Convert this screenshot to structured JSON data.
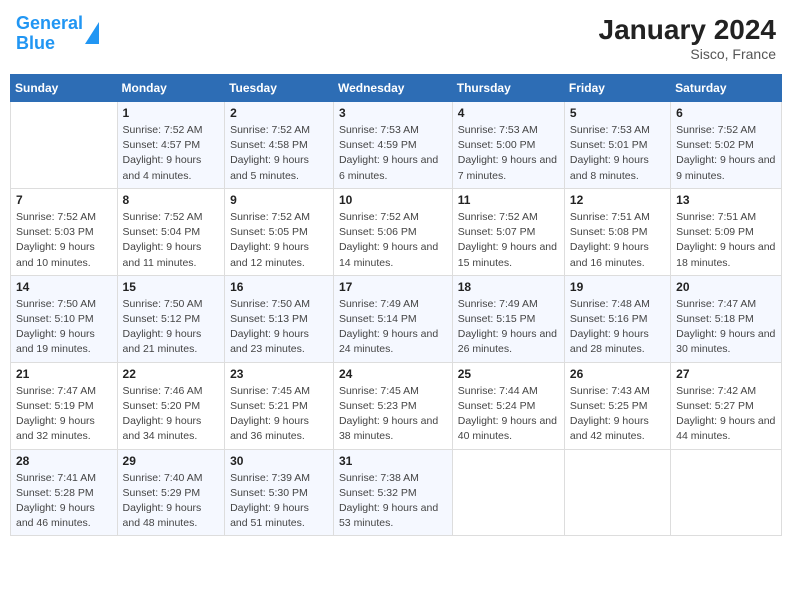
{
  "header": {
    "logo_line1": "General",
    "logo_line2": "Blue",
    "title": "January 2024",
    "subtitle": "Sisco, France"
  },
  "days_of_week": [
    "Sunday",
    "Monday",
    "Tuesday",
    "Wednesday",
    "Thursday",
    "Friday",
    "Saturday"
  ],
  "weeks": [
    [
      {
        "day": "",
        "sunrise": "",
        "sunset": "",
        "daylight": ""
      },
      {
        "day": "1",
        "sunrise": "Sunrise: 7:52 AM",
        "sunset": "Sunset: 4:57 PM",
        "daylight": "Daylight: 9 hours and 4 minutes."
      },
      {
        "day": "2",
        "sunrise": "Sunrise: 7:52 AM",
        "sunset": "Sunset: 4:58 PM",
        "daylight": "Daylight: 9 hours and 5 minutes."
      },
      {
        "day": "3",
        "sunrise": "Sunrise: 7:53 AM",
        "sunset": "Sunset: 4:59 PM",
        "daylight": "Daylight: 9 hours and 6 minutes."
      },
      {
        "day": "4",
        "sunrise": "Sunrise: 7:53 AM",
        "sunset": "Sunset: 5:00 PM",
        "daylight": "Daylight: 9 hours and 7 minutes."
      },
      {
        "day": "5",
        "sunrise": "Sunrise: 7:53 AM",
        "sunset": "Sunset: 5:01 PM",
        "daylight": "Daylight: 9 hours and 8 minutes."
      },
      {
        "day": "6",
        "sunrise": "Sunrise: 7:52 AM",
        "sunset": "Sunset: 5:02 PM",
        "daylight": "Daylight: 9 hours and 9 minutes."
      }
    ],
    [
      {
        "day": "7",
        "sunrise": "Sunrise: 7:52 AM",
        "sunset": "Sunset: 5:03 PM",
        "daylight": "Daylight: 9 hours and 10 minutes."
      },
      {
        "day": "8",
        "sunrise": "Sunrise: 7:52 AM",
        "sunset": "Sunset: 5:04 PM",
        "daylight": "Daylight: 9 hours and 11 minutes."
      },
      {
        "day": "9",
        "sunrise": "Sunrise: 7:52 AM",
        "sunset": "Sunset: 5:05 PM",
        "daylight": "Daylight: 9 hours and 12 minutes."
      },
      {
        "day": "10",
        "sunrise": "Sunrise: 7:52 AM",
        "sunset": "Sunset: 5:06 PM",
        "daylight": "Daylight: 9 hours and 14 minutes."
      },
      {
        "day": "11",
        "sunrise": "Sunrise: 7:52 AM",
        "sunset": "Sunset: 5:07 PM",
        "daylight": "Daylight: 9 hours and 15 minutes."
      },
      {
        "day": "12",
        "sunrise": "Sunrise: 7:51 AM",
        "sunset": "Sunset: 5:08 PM",
        "daylight": "Daylight: 9 hours and 16 minutes."
      },
      {
        "day": "13",
        "sunrise": "Sunrise: 7:51 AM",
        "sunset": "Sunset: 5:09 PM",
        "daylight": "Daylight: 9 hours and 18 minutes."
      }
    ],
    [
      {
        "day": "14",
        "sunrise": "Sunrise: 7:50 AM",
        "sunset": "Sunset: 5:10 PM",
        "daylight": "Daylight: 9 hours and 19 minutes."
      },
      {
        "day": "15",
        "sunrise": "Sunrise: 7:50 AM",
        "sunset": "Sunset: 5:12 PM",
        "daylight": "Daylight: 9 hours and 21 minutes."
      },
      {
        "day": "16",
        "sunrise": "Sunrise: 7:50 AM",
        "sunset": "Sunset: 5:13 PM",
        "daylight": "Daylight: 9 hours and 23 minutes."
      },
      {
        "day": "17",
        "sunrise": "Sunrise: 7:49 AM",
        "sunset": "Sunset: 5:14 PM",
        "daylight": "Daylight: 9 hours and 24 minutes."
      },
      {
        "day": "18",
        "sunrise": "Sunrise: 7:49 AM",
        "sunset": "Sunset: 5:15 PM",
        "daylight": "Daylight: 9 hours and 26 minutes."
      },
      {
        "day": "19",
        "sunrise": "Sunrise: 7:48 AM",
        "sunset": "Sunset: 5:16 PM",
        "daylight": "Daylight: 9 hours and 28 minutes."
      },
      {
        "day": "20",
        "sunrise": "Sunrise: 7:47 AM",
        "sunset": "Sunset: 5:18 PM",
        "daylight": "Daylight: 9 hours and 30 minutes."
      }
    ],
    [
      {
        "day": "21",
        "sunrise": "Sunrise: 7:47 AM",
        "sunset": "Sunset: 5:19 PM",
        "daylight": "Daylight: 9 hours and 32 minutes."
      },
      {
        "day": "22",
        "sunrise": "Sunrise: 7:46 AM",
        "sunset": "Sunset: 5:20 PM",
        "daylight": "Daylight: 9 hours and 34 minutes."
      },
      {
        "day": "23",
        "sunrise": "Sunrise: 7:45 AM",
        "sunset": "Sunset: 5:21 PM",
        "daylight": "Daylight: 9 hours and 36 minutes."
      },
      {
        "day": "24",
        "sunrise": "Sunrise: 7:45 AM",
        "sunset": "Sunset: 5:23 PM",
        "daylight": "Daylight: 9 hours and 38 minutes."
      },
      {
        "day": "25",
        "sunrise": "Sunrise: 7:44 AM",
        "sunset": "Sunset: 5:24 PM",
        "daylight": "Daylight: 9 hours and 40 minutes."
      },
      {
        "day": "26",
        "sunrise": "Sunrise: 7:43 AM",
        "sunset": "Sunset: 5:25 PM",
        "daylight": "Daylight: 9 hours and 42 minutes."
      },
      {
        "day": "27",
        "sunrise": "Sunrise: 7:42 AM",
        "sunset": "Sunset: 5:27 PM",
        "daylight": "Daylight: 9 hours and 44 minutes."
      }
    ],
    [
      {
        "day": "28",
        "sunrise": "Sunrise: 7:41 AM",
        "sunset": "Sunset: 5:28 PM",
        "daylight": "Daylight: 9 hours and 46 minutes."
      },
      {
        "day": "29",
        "sunrise": "Sunrise: 7:40 AM",
        "sunset": "Sunset: 5:29 PM",
        "daylight": "Daylight: 9 hours and 48 minutes."
      },
      {
        "day": "30",
        "sunrise": "Sunrise: 7:39 AM",
        "sunset": "Sunset: 5:30 PM",
        "daylight": "Daylight: 9 hours and 51 minutes."
      },
      {
        "day": "31",
        "sunrise": "Sunrise: 7:38 AM",
        "sunset": "Sunset: 5:32 PM",
        "daylight": "Daylight: 9 hours and 53 minutes."
      },
      {
        "day": "",
        "sunrise": "",
        "sunset": "",
        "daylight": ""
      },
      {
        "day": "",
        "sunrise": "",
        "sunset": "",
        "daylight": ""
      },
      {
        "day": "",
        "sunrise": "",
        "sunset": "",
        "daylight": ""
      }
    ]
  ]
}
